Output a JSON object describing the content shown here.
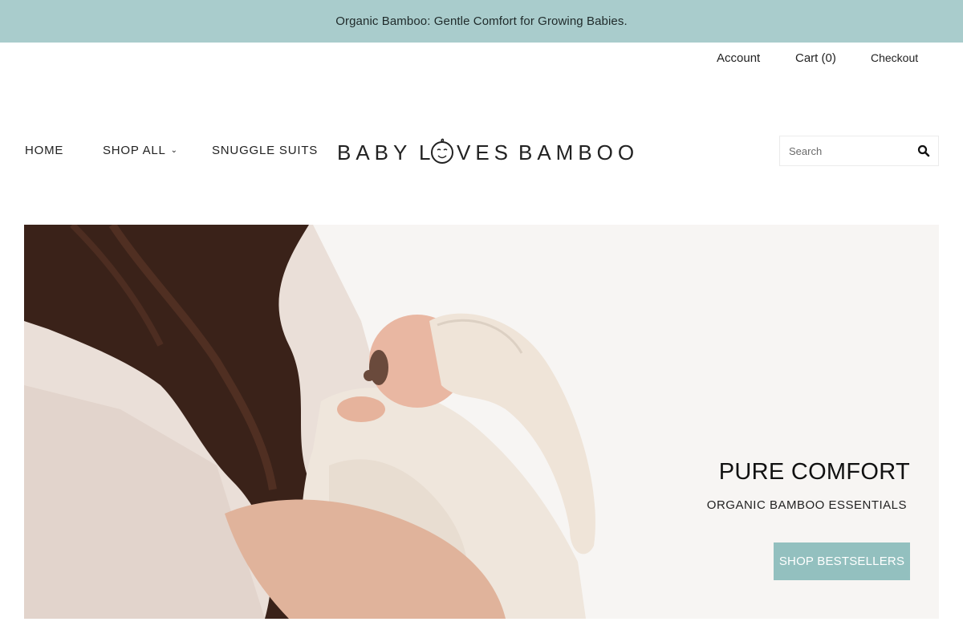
{
  "announcement": {
    "text": "Organic Bamboo: Gentle Comfort for Growing Babies."
  },
  "utility_nav": {
    "account": "Account",
    "cart": "Cart (0)",
    "checkout": "Checkout"
  },
  "main_nav": {
    "home": "HOME",
    "shop_all": "SHOP ALL",
    "snuggle_suits": "SNUGGLE SUITS"
  },
  "logo": {
    "text": "BABY LOVES BAMBOO"
  },
  "search": {
    "placeholder": "Search"
  },
  "hero": {
    "title": "PURE COMFORT",
    "subtitle": "ORGANIC BAMBOO ESSENTIALS",
    "button": "SHOP BESTSELLERS"
  },
  "colors": {
    "announcement_bg": "#a9cccc",
    "button_bg": "#93c0bf",
    "hero_bg": "#f7f5f3"
  },
  "icons": {
    "search": "search-icon",
    "chevron": "chevron-down-icon"
  }
}
